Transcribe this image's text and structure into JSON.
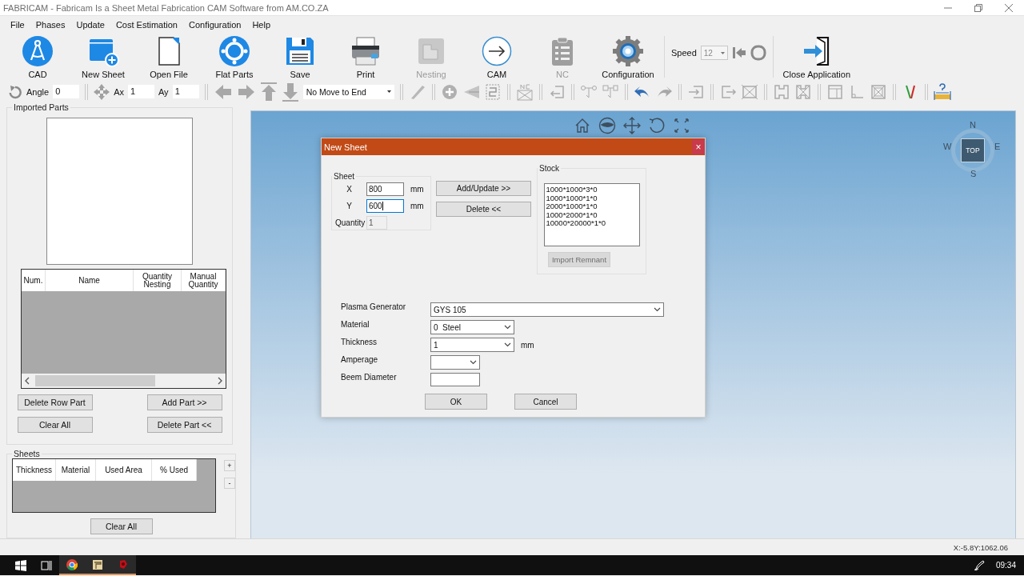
{
  "window": {
    "title": "FABRICAM - Fabricam Is a Sheet Metal Fabrication CAM Software from AM.CO.ZA"
  },
  "menu": [
    "File",
    "Phases",
    "Update",
    "Cost Estimation",
    "Configuration",
    "Help"
  ],
  "toolbar": {
    "buttons": [
      {
        "label": "CAD",
        "kind": "cad",
        "disabled": false
      },
      {
        "label": "New Sheet",
        "kind": "new-sheet",
        "disabled": false
      },
      {
        "label": "Open File",
        "kind": "open-file",
        "disabled": false
      },
      {
        "label": "Flat Parts",
        "kind": "flat-parts",
        "disabled": false
      },
      {
        "label": "Save",
        "kind": "save",
        "disabled": false
      },
      {
        "label": "Print",
        "kind": "print",
        "disabled": false
      },
      {
        "label": "Nesting",
        "kind": "nesting",
        "disabled": true
      },
      {
        "label": "CAM",
        "kind": "cam",
        "disabled": false
      },
      {
        "label": "NC",
        "kind": "nc",
        "disabled": true
      },
      {
        "label": "Configuration",
        "kind": "configuration",
        "disabled": false
      }
    ],
    "speed": {
      "label": "Speed",
      "value": "12"
    },
    "close_button": {
      "label": "Close Application",
      "kind": "exit"
    }
  },
  "transform_bar": {
    "angle": {
      "label": "Angle",
      "value": "0"
    },
    "ax": {
      "label": "Ax",
      "value": "1"
    },
    "ay": {
      "label": "Ay",
      "value": "1"
    },
    "move_mode": "No Move to End"
  },
  "imported_parts": {
    "title": "Imported Parts",
    "columns": [
      "Num.",
      "Name",
      "Quantity Nesting",
      "Manual Quantity"
    ],
    "buttons": [
      "Delete Row Part",
      "Add Part >>",
      "Clear All",
      "Delete Part <<"
    ]
  },
  "sheets": {
    "title": "Sheets",
    "columns": [
      "Thickness",
      "Material",
      "Used Area",
      "% Used"
    ],
    "side_buttons": [
      "+",
      "-"
    ],
    "clear_button": "Clear All"
  },
  "viewport": {
    "compass": {
      "north": "N",
      "south": "S",
      "east": "E",
      "west": "W",
      "face": "TOP"
    }
  },
  "dialog": {
    "title": "New Sheet",
    "close": "×",
    "sheet": {
      "title": "Sheet",
      "fields": [
        {
          "label": "X",
          "value": "800",
          "unit": "mm",
          "focused": false
        },
        {
          "label": "Y",
          "value": "600",
          "unit": "mm",
          "focused": true
        }
      ],
      "quantity": {
        "label": "Quantity",
        "value": "1",
        "disabled": true
      }
    },
    "actions": [
      "Add/Update >>",
      "Delete <<"
    ],
    "stock": {
      "title": "Stock",
      "items": [
        "1000*1000*3*0",
        "1000*1000*1*0",
        "2000*1000*1*0",
        "1000*2000*1*0",
        "10000*20000*1*0"
      ],
      "import_button": {
        "label": "Import Remnant",
        "disabled": true
      }
    },
    "fields": [
      {
        "kind": "dropdown",
        "label": "Plasma Generator",
        "value": "GYS 105"
      },
      {
        "kind": "dropdown",
        "label": "Material",
        "value": "0  Steel"
      },
      {
        "kind": "dropdown",
        "label": "Thickness",
        "value": "1",
        "unit": "mm"
      },
      {
        "kind": "dropdown",
        "label": "Amperage"
      },
      {
        "kind": "input",
        "label": "Beem Diameter"
      }
    ],
    "buttons": [
      "OK",
      "Cancel"
    ]
  },
  "status_bar": {
    "coordinates": "X:-5.8Y:1062.06"
  },
  "taskbar": {
    "clock": "09:34"
  }
}
